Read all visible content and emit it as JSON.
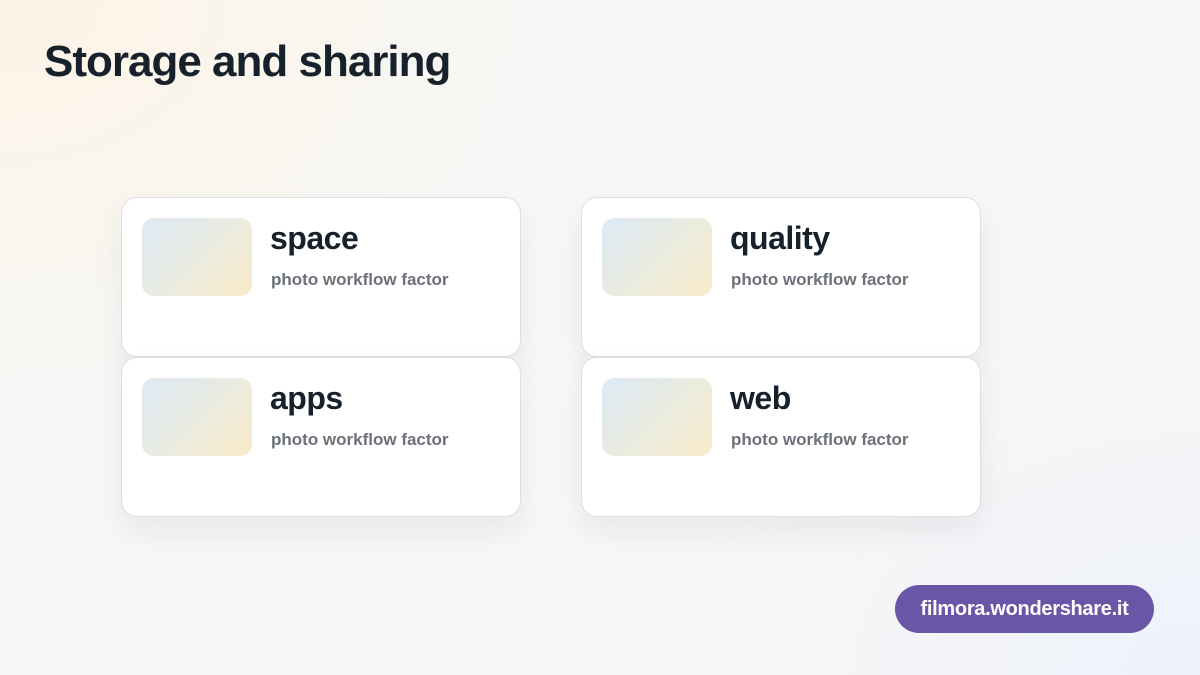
{
  "page": {
    "title": "Storage and sharing"
  },
  "cards": [
    {
      "title": "space",
      "subtitle": "photo workflow factor",
      "thumbnail": "image-placeholder"
    },
    {
      "title": "quality",
      "subtitle": "photo workflow factor",
      "thumbnail": "image-placeholder"
    },
    {
      "title": "apps",
      "subtitle": "photo workflow factor",
      "thumbnail": "image-placeholder"
    },
    {
      "title": "web",
      "subtitle": "photo workflow factor",
      "thumbnail": "image-placeholder"
    }
  ],
  "badge": {
    "label": "filmora.wondershare.it",
    "color": "#6a56a6"
  },
  "colors": {
    "heading": "#17212b",
    "subtitle": "#6b7079",
    "card_background": "#ffffff",
    "card_border": "#dedfe2"
  }
}
